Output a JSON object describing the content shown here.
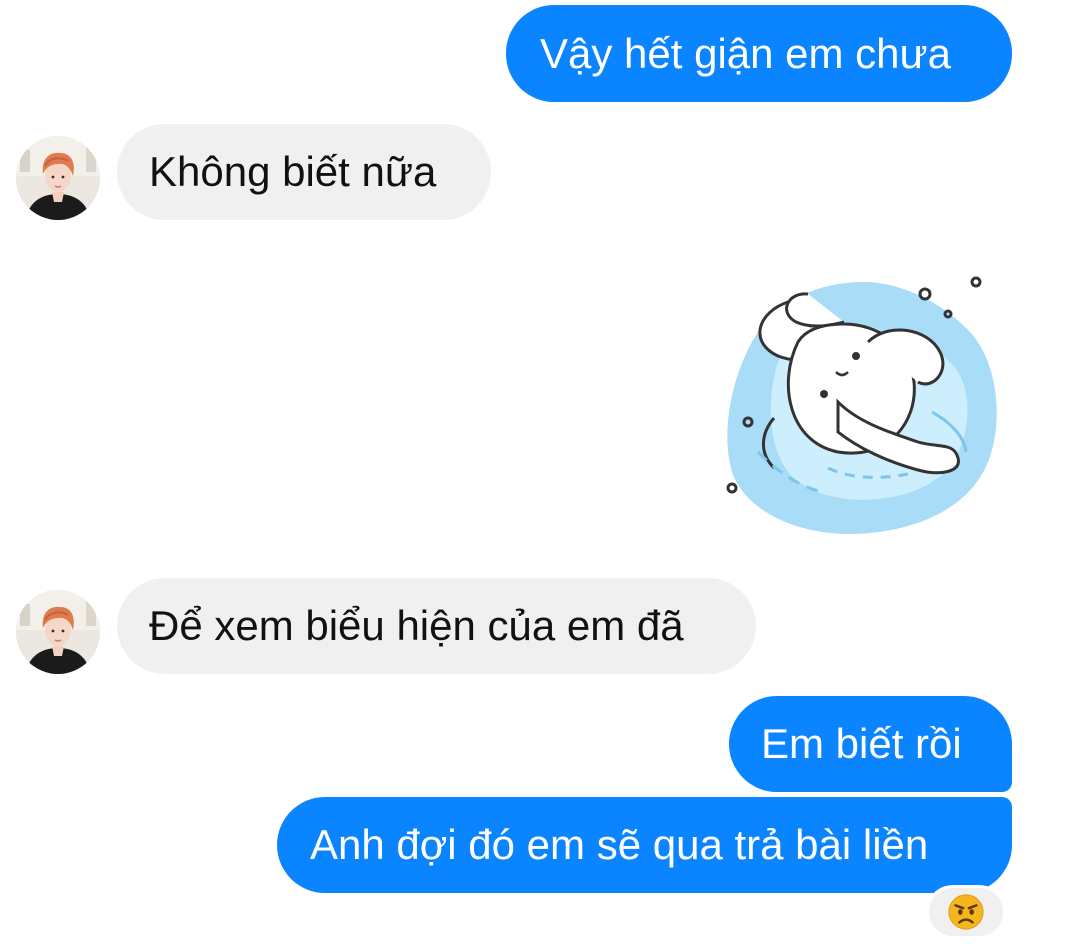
{
  "messages": [
    {
      "id": 1,
      "direction": "outgoing",
      "text": "Vậy hết giận em chưa"
    },
    {
      "id": 2,
      "direction": "incoming",
      "text": "Không biết nữa"
    },
    {
      "id": 3,
      "direction": "outgoing",
      "type": "sticker",
      "sticker": "splashing-bunny-sticker"
    },
    {
      "id": 4,
      "direction": "incoming",
      "text": "Để xem biểu hiện của em đã"
    },
    {
      "id": 5,
      "direction": "outgoing",
      "text": "Em biết rồi"
    },
    {
      "id": 6,
      "direction": "outgoing",
      "text": "Anh đợi đó em sẽ qua trả bài liền",
      "reaction": "angry-face-emoji"
    }
  ],
  "colors": {
    "outgoing_bubble": "#0a84ff",
    "incoming_bubble": "#f0f0f0",
    "background": "#ffffff"
  }
}
